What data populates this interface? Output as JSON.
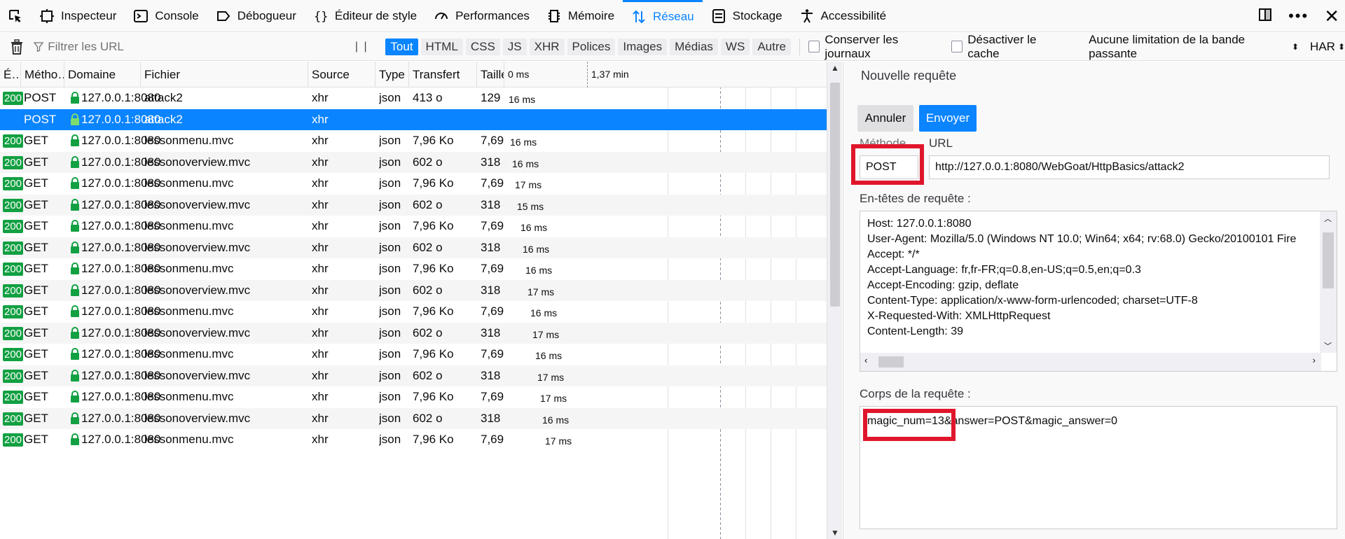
{
  "toolbar": {
    "tabs": [
      {
        "label": "Inspecteur",
        "icon": "inspector-icon"
      },
      {
        "label": "Console",
        "icon": "console-icon"
      },
      {
        "label": "Débogueur",
        "icon": "debugger-icon"
      },
      {
        "label": "Éditeur de style",
        "icon": "style-editor-icon"
      },
      {
        "label": "Performances",
        "icon": "performance-icon"
      },
      {
        "label": "Mémoire",
        "icon": "memory-icon"
      },
      {
        "label": "Réseau",
        "icon": "network-icon",
        "selected": true
      },
      {
        "label": "Stockage",
        "icon": "storage-icon"
      },
      {
        "label": "Accessibilité",
        "icon": "accessibility-icon"
      }
    ]
  },
  "filterbar": {
    "placeholder": "Filtrer les URL",
    "pause": "| |",
    "types": [
      "Tout",
      "HTML",
      "CSS",
      "JS",
      "XHR",
      "Polices",
      "Images",
      "Médias",
      "WS",
      "Autre"
    ],
    "active_type": "Tout",
    "persist_logs": "Conserver les journaux",
    "disable_cache": "Désactiver le cache",
    "throttling": "Aucune limitation de la bande passante",
    "har": "HAR"
  },
  "table": {
    "columns": [
      "É…",
      "Métho…",
      "Domaine",
      "Fichier",
      "Source",
      "Type",
      "Transfert",
      "Taille",
      "0 ms",
      "1,37 min"
    ],
    "rows": [
      {
        "status": "200",
        "method": "POST",
        "domain": "127.0.0.1:8080",
        "file": "attack2",
        "source": "xhr",
        "type": "json",
        "transfer": "413 o",
        "size": "129 o",
        "time": "16 ms"
      },
      {
        "status": "",
        "method": "POST",
        "domain": "127.0.0.1:8080",
        "file": "attack2",
        "source": "xhr",
        "type": "",
        "transfer": "",
        "size": "",
        "time": "",
        "selected": true
      },
      {
        "status": "200",
        "method": "GET",
        "domain": "127.0.0.1:8080",
        "file": "lessonmenu.mvc",
        "source": "xhr",
        "type": "json",
        "transfer": "7,96 Ko",
        "size": "7,69…",
        "time": "16 ms"
      },
      {
        "status": "200",
        "method": "GET",
        "domain": "127.0.0.1:8080",
        "file": "lessonoverview.mvc",
        "source": "xhr",
        "type": "json",
        "transfer": "602 o",
        "size": "318 o",
        "time": "16 ms"
      },
      {
        "status": "200",
        "method": "GET",
        "domain": "127.0.0.1:8080",
        "file": "lessonmenu.mvc",
        "source": "xhr",
        "type": "json",
        "transfer": "7,96 Ko",
        "size": "7,69…",
        "time": "17 ms"
      },
      {
        "status": "200",
        "method": "GET",
        "domain": "127.0.0.1:8080",
        "file": "lessonoverview.mvc",
        "source": "xhr",
        "type": "json",
        "transfer": "602 o",
        "size": "318 o",
        "time": "15 ms"
      },
      {
        "status": "200",
        "method": "GET",
        "domain": "127.0.0.1:8080",
        "file": "lessonmenu.mvc",
        "source": "xhr",
        "type": "json",
        "transfer": "7,96 Ko",
        "size": "7,69…",
        "time": "16 ms"
      },
      {
        "status": "200",
        "method": "GET",
        "domain": "127.0.0.1:8080",
        "file": "lessonoverview.mvc",
        "source": "xhr",
        "type": "json",
        "transfer": "602 o",
        "size": "318 o",
        "time": "16 ms"
      },
      {
        "status": "200",
        "method": "GET",
        "domain": "127.0.0.1:8080",
        "file": "lessonmenu.mvc",
        "source": "xhr",
        "type": "json",
        "transfer": "7,96 Ko",
        "size": "7,69…",
        "time": "16 ms"
      },
      {
        "status": "200",
        "method": "GET",
        "domain": "127.0.0.1:8080",
        "file": "lessonoverview.mvc",
        "source": "xhr",
        "type": "json",
        "transfer": "602 o",
        "size": "318 o",
        "time": "17 ms"
      },
      {
        "status": "200",
        "method": "GET",
        "domain": "127.0.0.1:8080",
        "file": "lessonmenu.mvc",
        "source": "xhr",
        "type": "json",
        "transfer": "7,96 Ko",
        "size": "7,69…",
        "time": "16 ms"
      },
      {
        "status": "200",
        "method": "GET",
        "domain": "127.0.0.1:8080",
        "file": "lessonoverview.mvc",
        "source": "xhr",
        "type": "json",
        "transfer": "602 o",
        "size": "318 o",
        "time": "17 ms"
      },
      {
        "status": "200",
        "method": "GET",
        "domain": "127.0.0.1:8080",
        "file": "lessonmenu.mvc",
        "source": "xhr",
        "type": "json",
        "transfer": "7,96 Ko",
        "size": "7,69…",
        "time": "16 ms"
      },
      {
        "status": "200",
        "method": "GET",
        "domain": "127.0.0.1:8080",
        "file": "lessonoverview.mvc",
        "source": "xhr",
        "type": "json",
        "transfer": "602 o",
        "size": "318 o",
        "time": "17 ms"
      },
      {
        "status": "200",
        "method": "GET",
        "domain": "127.0.0.1:8080",
        "file": "lessonmenu.mvc",
        "source": "xhr",
        "type": "json",
        "transfer": "7,96 Ko",
        "size": "7,69…",
        "time": "17 ms"
      },
      {
        "status": "200",
        "method": "GET",
        "domain": "127.0.0.1:8080",
        "file": "lessonoverview.mvc",
        "source": "xhr",
        "type": "json",
        "transfer": "602 o",
        "size": "318 o",
        "time": "16 ms"
      },
      {
        "status": "200",
        "method": "GET",
        "domain": "127.0.0.1:8080",
        "file": "lessonmenu.mvc",
        "source": "xhr",
        "type": "json",
        "transfer": "7,96 Ko",
        "size": "7,69…",
        "time": "17 ms"
      }
    ]
  },
  "panel": {
    "title": "Nouvelle requête",
    "cancel": "Annuler",
    "send": "Envoyer",
    "method_label": "Méthode",
    "url_label": "URL",
    "method": "POST",
    "url": "http://127.0.0.1:8080/WebGoat/HttpBasics/attack2",
    "headers_label": "En-têtes de requête :",
    "headers": [
      "Host: 127.0.0.1:8080",
      "User-Agent: Mozilla/5.0 (Windows NT 10.0; Win64; x64; rv:68.0) Gecko/20100101 Fire",
      "Accept: */*",
      "Accept-Language: fr,fr-FR;q=0.8,en-US;q=0.5,en;q=0.3",
      "Accept-Encoding: gzip, deflate",
      "Content-Type: application/x-www-form-urlencoded; charset=UTF-8",
      "X-Requested-With: XMLHttpRequest",
      "Content-Length: 39"
    ],
    "body_label": "Corps de la requête :",
    "body": "magic_num=13&answer=POST&magic_answer=0"
  },
  "colors": {
    "accent": "#0a84ff",
    "status_ok": "#12a042",
    "highlight": "#e0162b"
  }
}
